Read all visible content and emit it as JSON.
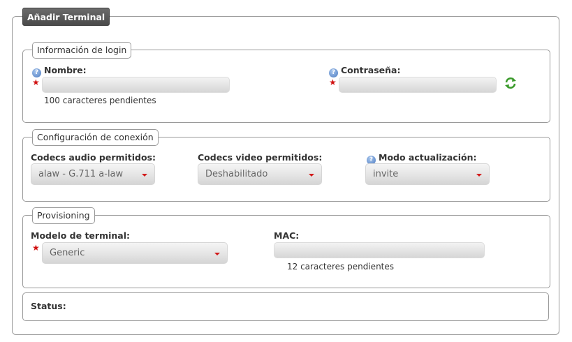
{
  "panel": {
    "title": "Añadir Terminal"
  },
  "login": {
    "legend": "Información de login",
    "nombre_label": "Nombre:",
    "nombre_value": "",
    "nombre_hint": "100 caracteres pendientes",
    "password_label": "Contraseña:",
    "password_value": ""
  },
  "conexion": {
    "legend": "Configuración de conexión",
    "audio_label": "Codecs audio permitidos:",
    "audio_value": "alaw - G.711 a-law",
    "video_label": "Codecs video permitidos:",
    "video_value": "Deshabilitado",
    "modo_label": "Modo actualización:",
    "modo_value": "invite"
  },
  "provisioning": {
    "legend": "Provisioning",
    "modelo_label": "Modelo de terminal:",
    "modelo_value": "Generic",
    "mac_label": "MAC:",
    "mac_value": "",
    "mac_hint": "12 caracteres pendientes"
  },
  "status": {
    "label": "Status:"
  },
  "icons": {
    "help": "help-icon",
    "required": "required-star-icon",
    "refresh": "refresh-icon",
    "dropdown": "dropdown-caret-icon"
  },
  "colors": {
    "required": "#d01010",
    "refresh": "#3a9a2a",
    "help": "#4a79c0"
  }
}
